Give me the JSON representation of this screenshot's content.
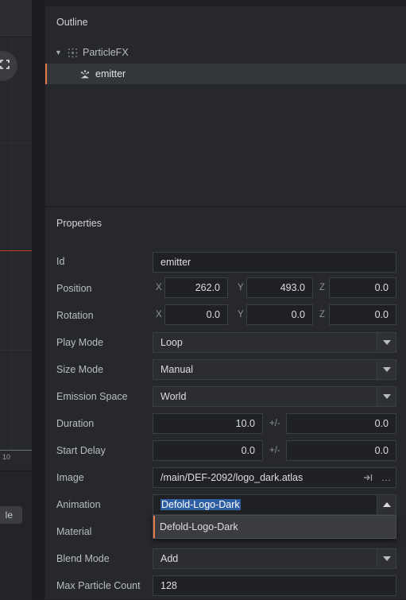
{
  "left_panel": {
    "axis_tick": "10",
    "button_label": "le"
  },
  "outline": {
    "title": "Outline",
    "items": [
      {
        "label": "ParticleFX",
        "icon": "particlefx-icon",
        "expanded": true
      },
      {
        "label": "emitter",
        "icon": "emitter-icon",
        "selected": true
      }
    ]
  },
  "properties": {
    "title": "Properties",
    "id": {
      "label": "Id",
      "value": "emitter"
    },
    "position": {
      "label": "Position",
      "x_tag": "X",
      "y_tag": "Y",
      "z_tag": "Z",
      "x": "262.0",
      "y": "493.0",
      "z": "0.0"
    },
    "rotation": {
      "label": "Rotation",
      "x_tag": "X",
      "y_tag": "Y",
      "z_tag": "Z",
      "x": "0.0",
      "y": "0.0",
      "z": "0.0"
    },
    "play_mode": {
      "label": "Play Mode",
      "value": "Loop"
    },
    "size_mode": {
      "label": "Size Mode",
      "value": "Manual"
    },
    "emission_space": {
      "label": "Emission Space",
      "value": "World"
    },
    "duration": {
      "label": "Duration",
      "value": "10.0",
      "pm": "+/-",
      "spread": "0.0"
    },
    "start_delay": {
      "label": "Start Delay",
      "value": "0.0",
      "pm": "+/-",
      "spread": "0.0"
    },
    "image": {
      "label": "Image",
      "value": "/main/DEF-2092/logo_dark.atlas",
      "browse_label": "…"
    },
    "animation": {
      "label": "Animation",
      "value": "Defold-Logo-Dark",
      "options": [
        "Defold-Logo-Dark"
      ]
    },
    "material": {
      "label": "Material"
    },
    "blend_mode": {
      "label": "Blend Mode",
      "value": "Add"
    },
    "max_particle_count": {
      "label": "Max Particle Count",
      "value": "128"
    }
  },
  "colors": {
    "accent": "#e8794a",
    "selection": "#2f5fa3",
    "red_line": "#c0392b"
  }
}
